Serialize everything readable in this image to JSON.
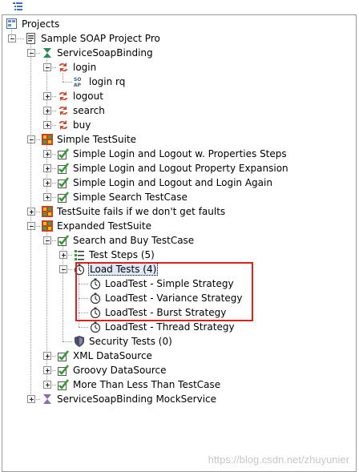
{
  "colors": {
    "accent_red": "#e0201c",
    "selected_bg": "#dfe8f6",
    "suite_green": "#2f9a2f"
  },
  "tree": [
    {
      "label": "Projects",
      "icon": "projects-icon",
      "depth": 0,
      "expander": "none"
    },
    {
      "label": "Sample SOAP Project Pro",
      "icon": "project-icon",
      "depth": 1,
      "expander": "minus"
    },
    {
      "label": "ServiceSoapBinding",
      "icon": "interface-icon",
      "depth": 2,
      "expander": "minus"
    },
    {
      "label": "login",
      "icon": "operation-icon",
      "depth": 3,
      "expander": "minus"
    },
    {
      "label": "login rq",
      "icon": "soap-request-icon",
      "depth": 4,
      "expander": "none"
    },
    {
      "label": "logout",
      "icon": "operation-icon",
      "depth": 3,
      "expander": "plus"
    },
    {
      "label": "search",
      "icon": "operation-icon",
      "depth": 3,
      "expander": "plus"
    },
    {
      "label": "buy",
      "icon": "operation-icon",
      "depth": 3,
      "expander": "plus"
    },
    {
      "label": "Simple TestSuite",
      "icon": "testsuite-icon",
      "depth": 2,
      "expander": "minus"
    },
    {
      "label": "Simple Login and Logout w. Properties Steps",
      "icon": "testcase-icon",
      "depth": 3,
      "expander": "plus"
    },
    {
      "label": "Simple Login and Logout Property Expansion",
      "icon": "testcase-icon",
      "depth": 3,
      "expander": "plus"
    },
    {
      "label": "Simple Login and Logout and Login Again",
      "icon": "testcase-icon",
      "depth": 3,
      "expander": "plus"
    },
    {
      "label": "Simple Search TestCase",
      "icon": "testcase-icon",
      "depth": 3,
      "expander": "plus"
    },
    {
      "label": "TestSuite fails if we don't get faults",
      "icon": "testsuite-icon",
      "depth": 2,
      "expander": "plus"
    },
    {
      "label": "Expanded TestSuite",
      "icon": "testsuite-icon",
      "depth": 2,
      "expander": "minus"
    },
    {
      "label": "Search and Buy TestCase",
      "icon": "testcase-icon",
      "depth": 3,
      "expander": "minus"
    },
    {
      "label": "Test Steps (5)",
      "icon": "teststeps-icon",
      "depth": 4,
      "expander": "plus"
    },
    {
      "label": "Load Tests (4)",
      "icon": "loadtest-icon",
      "depth": 4,
      "expander": "minus",
      "selected": true
    },
    {
      "label": "LoadTest - Simple Strategy",
      "icon": "loadtest-icon",
      "depth": 5,
      "expander": "none"
    },
    {
      "label": "LoadTest - Variance Strategy",
      "icon": "loadtest-icon",
      "depth": 5,
      "expander": "none"
    },
    {
      "label": "LoadTest - Burst Strategy",
      "icon": "loadtest-icon",
      "depth": 5,
      "expander": "none"
    },
    {
      "label": "LoadTest - Thread Strategy",
      "icon": "loadtest-icon",
      "depth": 5,
      "expander": "none"
    },
    {
      "label": "Security Tests (0)",
      "icon": "securitytest-icon",
      "depth": 4,
      "expander": "none"
    },
    {
      "label": "XML DataSource",
      "icon": "testcase-icon",
      "depth": 3,
      "expander": "plus"
    },
    {
      "label": "Groovy DataSource",
      "icon": "testcase-icon",
      "depth": 3,
      "expander": "plus"
    },
    {
      "label": "More Than Less Than TestCase",
      "icon": "testcase-icon",
      "depth": 3,
      "expander": "plus"
    },
    {
      "label": "ServiceSoapBinding MockService",
      "icon": "mockservice-icon",
      "depth": 2,
      "expander": "plus"
    }
  ],
  "watermark": "https://blog.csdn.net/zhuyunier"
}
